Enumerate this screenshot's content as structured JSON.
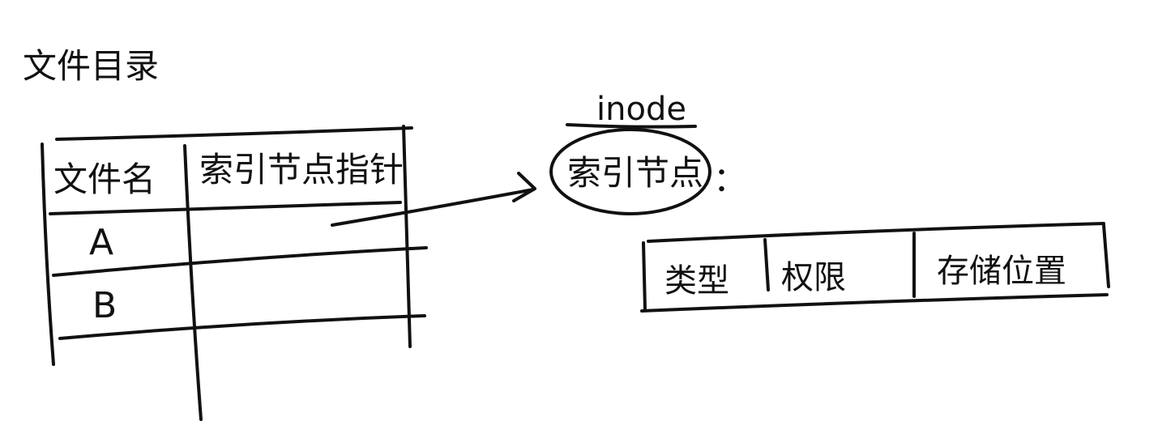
{
  "title": "文件目录",
  "directory_table": {
    "headers": [
      "文件名",
      "索引节点指针"
    ],
    "rows": [
      {
        "name": "A"
      },
      {
        "name": "B"
      }
    ]
  },
  "inode_label": "inode",
  "inode_circle_label": "索引节点",
  "inode_colon": "：",
  "inode_fields": [
    "类型",
    "权限",
    "存储位置"
  ]
}
